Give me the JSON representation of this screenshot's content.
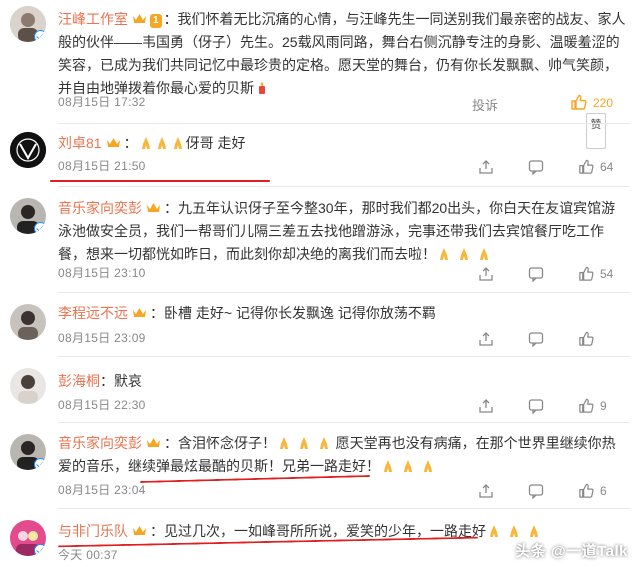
{
  "colors": {
    "username": "#eb7350",
    "accent_orange": "#f5a623",
    "underline_red": "#e02020",
    "meta_gray": "#888888"
  },
  "main_post": {
    "username": "汪峰工作室",
    "level_badge": "1",
    "text": "：我们怀着无比沉痛的心情，与汪峰先生一同送别我们最亲密的战友、家人般的伙伴——韦国勇（伢子）先生。25载风雨同路，舞台右侧沉静专注的身影、温暖羞涩的笑容，已成为我们共同记忆中最珍贵的定格。愿天堂的舞台，仍有你长发飘飘、帅气笑颜，并自由地弹拨着你最心爱的贝斯",
    "time": "08月15日 17:32",
    "report_label": "投诉",
    "like_count": "220",
    "tooltip": "赞"
  },
  "comments": [
    {
      "username": "刘卓81",
      "text": "伢哥 走好",
      "text_prefix_emojis": 3,
      "time": "08月15日 21:50",
      "like_count": "64"
    },
    {
      "username": "音乐家向奕彭",
      "text": "：九五年认识伢子至今整30年，那时我们都20出头，你白天在友谊宾馆游泳池做安全员，我们一帮哥们儿隔三差五去找他蹭游泳，完事还带我们去宾馆餐厅吃工作餐，想来一切都恍如昨日，而此刻你却决绝的离我们而去啦！",
      "time": "08月15日 23:10",
      "like_count": "54"
    },
    {
      "username": "李程远不远",
      "text": "：卧槽 走好~ 记得你长发飘逸 记得你放荡不羁",
      "time": "08月15日 23:09",
      "like_count": ""
    },
    {
      "username": "彭海桐",
      "text": "：默哀",
      "time": "08月15日 22:30",
      "like_count": "9"
    },
    {
      "username": "音乐家向奕彭",
      "text_part1": "：含泪怀念伢子！",
      "text_part2": "愿天堂再也没有病痛，在那个世界里继续你热爱的音乐，继续弹最炫最酷的贝斯！兄弟一路走好！",
      "time": "08月15日 23:04",
      "like_count": "6"
    },
    {
      "username": "与非门乐队",
      "text": "：见过几次，一如峰哥所所说，爱笑的少年，一路走好",
      "time": "今天 00:37",
      "like_count": ""
    }
  ],
  "watermark": "头条 @一道Talk",
  "icons": [
    "verified-icon",
    "crown-icon",
    "share-icon",
    "comment-icon",
    "like-icon",
    "prayer-emoji",
    "candle-emoji"
  ]
}
